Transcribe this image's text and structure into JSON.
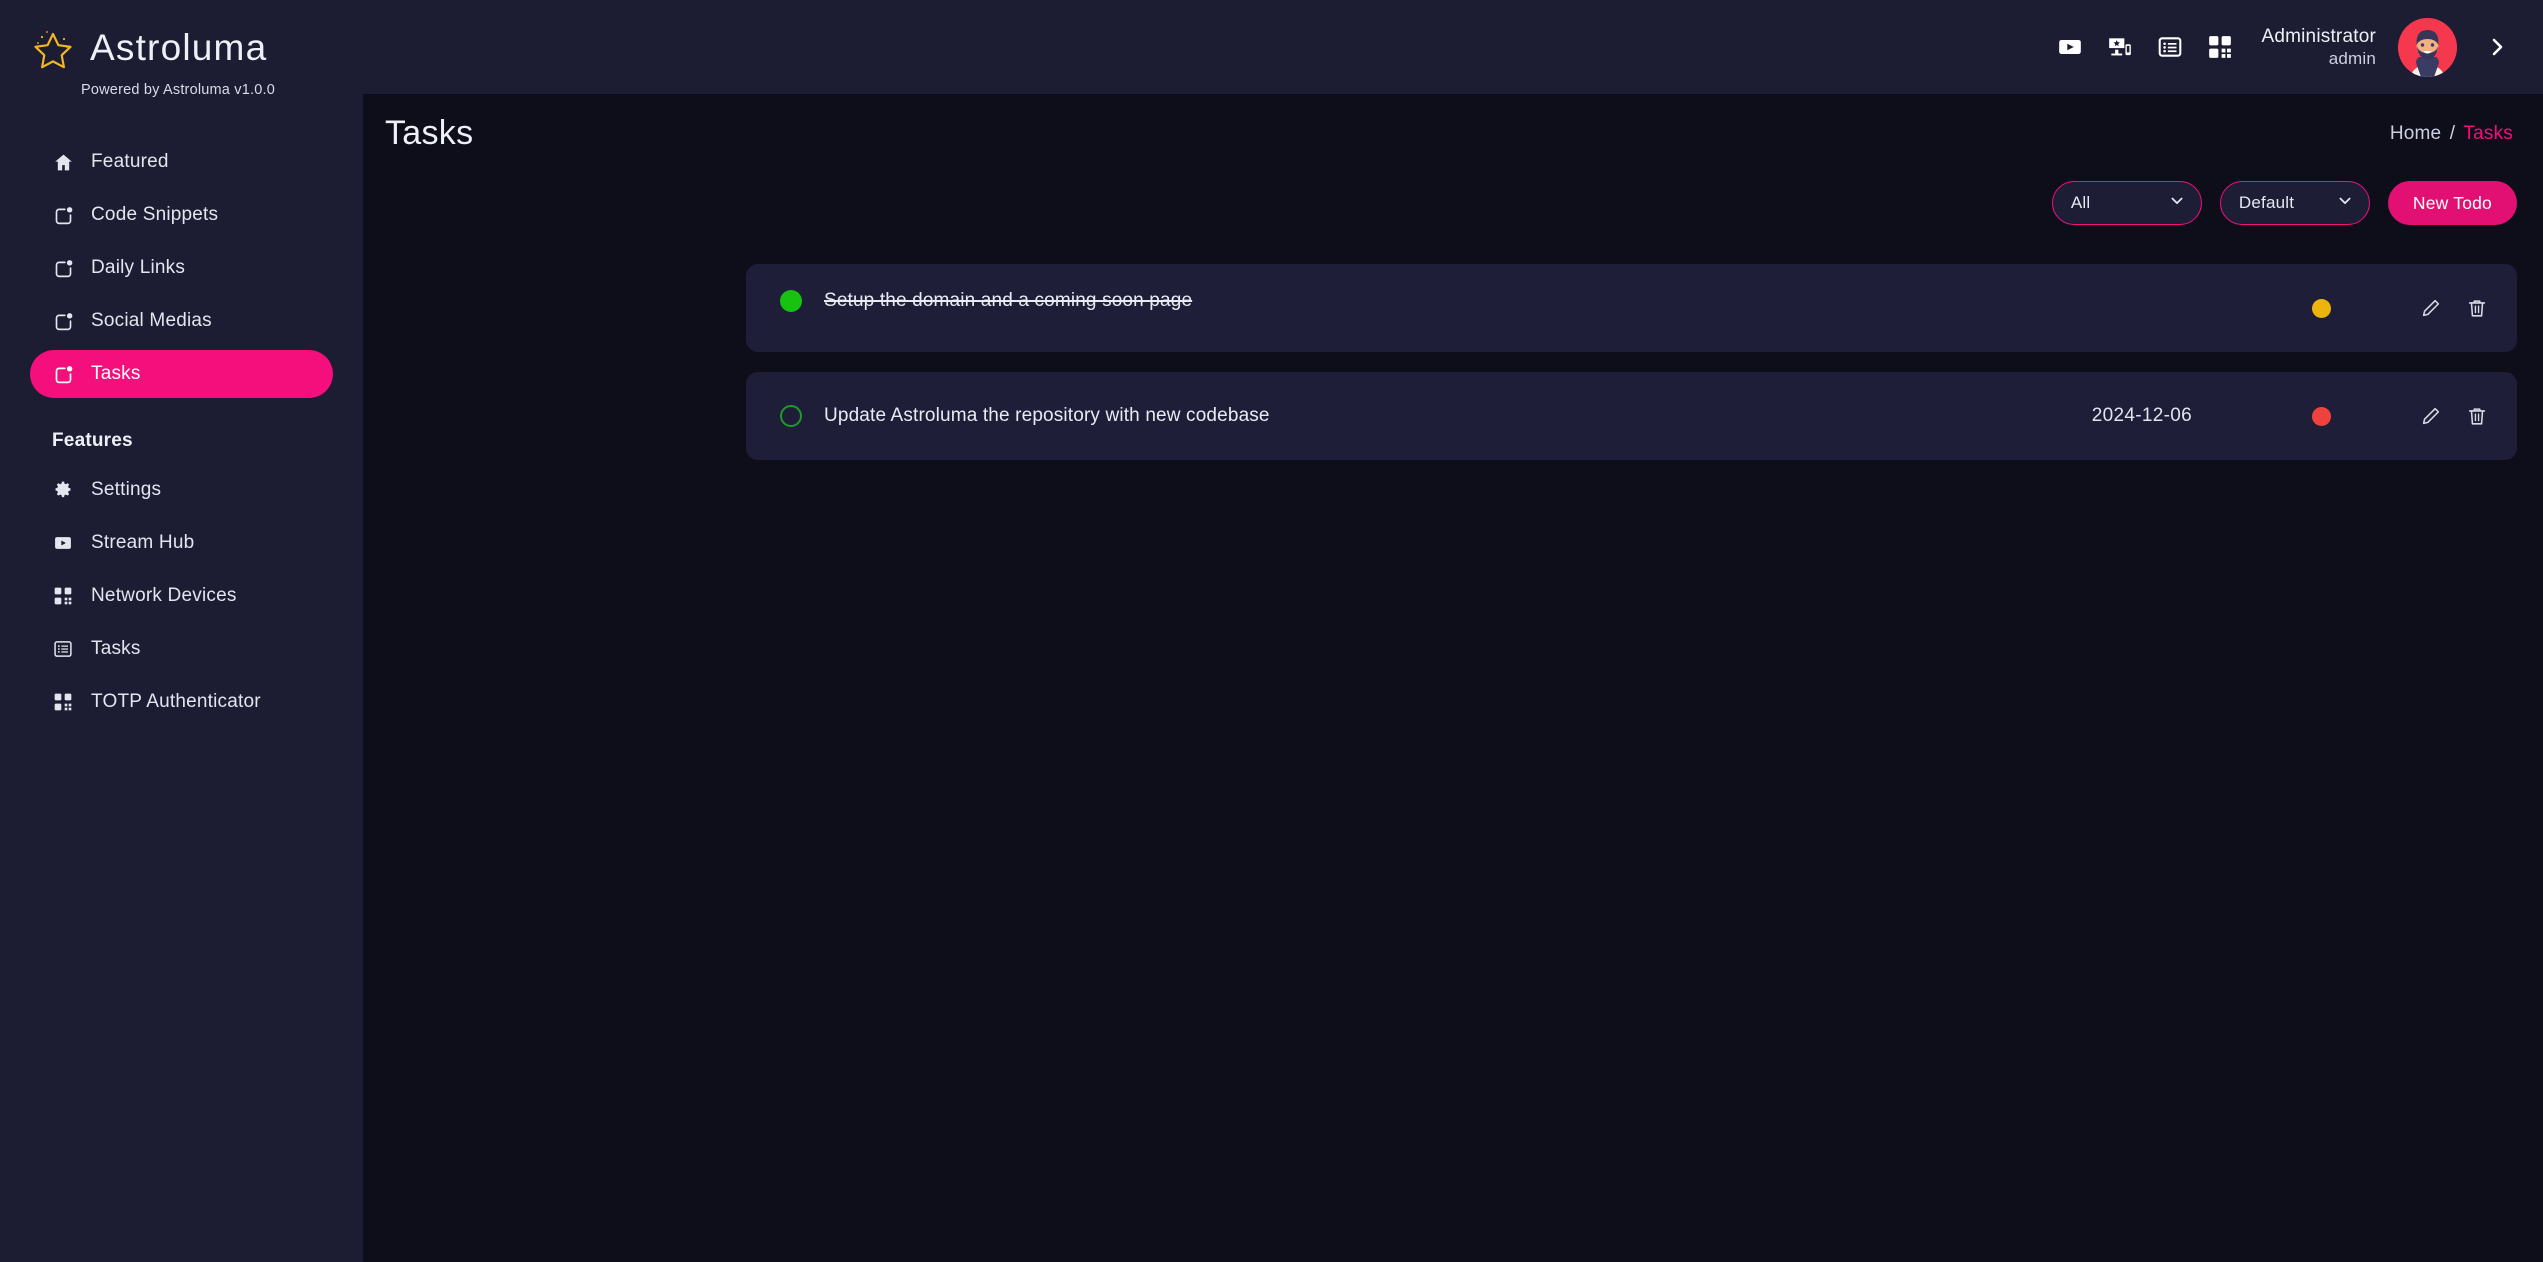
{
  "brand": {
    "title": "Astroluma",
    "subtitle": "Powered by Astroluma v1.0.0",
    "logo_icon": "star-icon",
    "accent_color": "#f50f7c"
  },
  "sidebar": {
    "items": [
      {
        "label": "Featured",
        "icon": "home-icon",
        "active": false
      },
      {
        "label": "Code Snippets",
        "icon": "external-window-icon",
        "active": false
      },
      {
        "label": "Daily Links",
        "icon": "external-window-icon",
        "active": false
      },
      {
        "label": "Social Medias",
        "icon": "external-window-icon",
        "active": false
      },
      {
        "label": "Tasks",
        "icon": "external-window-icon",
        "active": true
      }
    ],
    "section_label": "Features",
    "feature_items": [
      {
        "label": "Settings",
        "icon": "gear-icon"
      },
      {
        "label": "Stream Hub",
        "icon": "play-icon"
      },
      {
        "label": "Network Devices",
        "icon": "qr-code-icon"
      },
      {
        "label": "Tasks",
        "icon": "list-icon"
      },
      {
        "label": "TOTP Authenticator",
        "icon": "qr-code-icon"
      }
    ]
  },
  "topbar": {
    "icons": [
      "play-icon",
      "devices-icon",
      "list-icon",
      "qr-code-icon"
    ],
    "user_name": "Administrator",
    "user_role": "admin",
    "avatar_icon": "avatar",
    "collapse_icon": "chevron-right-icon"
  },
  "page": {
    "title": "Tasks",
    "breadcrumb": {
      "home": "Home",
      "separator": "/",
      "current": "Tasks"
    }
  },
  "toolbar": {
    "filter_select": {
      "value": "All",
      "caret": "chevron-down-icon"
    },
    "sort_select": {
      "value": "Default",
      "caret": "chevron-down-icon"
    },
    "new_button": "New Todo"
  },
  "tasks": [
    {
      "title": "Setup the domain and a coming soon page",
      "completed": true,
      "due_date": "",
      "priority_color": "#edb40d",
      "check_color": "#18c211",
      "edit_icon": "pencil-icon",
      "delete_icon": "trash-icon"
    },
    {
      "title": "Update Astroluma the repository with new codebase",
      "completed": false,
      "due_date": "2024-12-06",
      "priority_color": "#f0423d",
      "check_color": "#1d9b2a",
      "edit_icon": "pencil-icon",
      "delete_icon": "trash-icon"
    }
  ]
}
